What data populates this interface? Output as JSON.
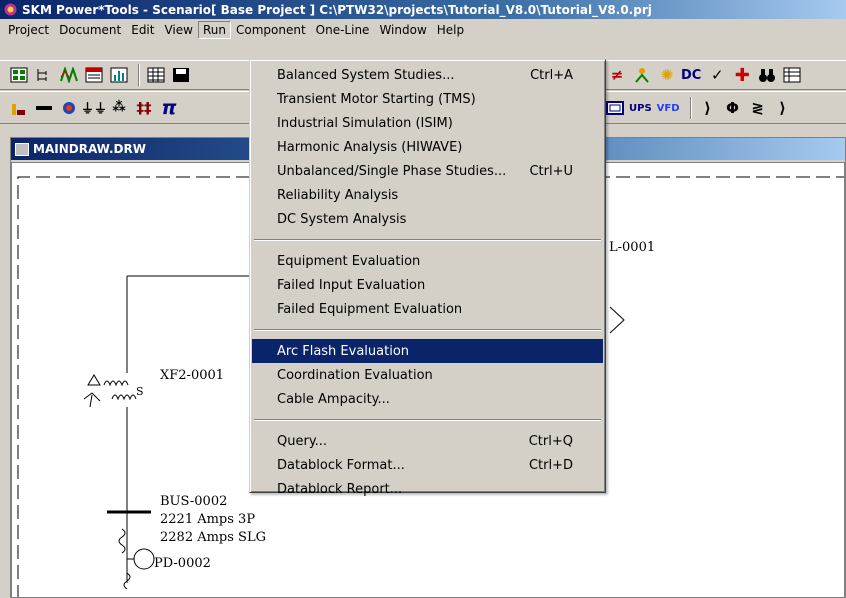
{
  "window": {
    "title": "SKM Power*Tools - Scenario[ Base Project ] C:\\PTW32\\projects\\Tutorial_V8.0\\Tutorial_V8.0.prj"
  },
  "menubar": {
    "items": [
      {
        "label": "Project"
      },
      {
        "label": "Document"
      },
      {
        "label": "Edit"
      },
      {
        "label": "View"
      },
      {
        "label": "Run"
      },
      {
        "label": "Component"
      },
      {
        "label": "One-Line"
      },
      {
        "label": "Window"
      },
      {
        "label": "Help"
      }
    ]
  },
  "toolbar2": {
    "ups_label": "UPS",
    "vfd_label": "VFD"
  },
  "toolbar_text": {
    "dc_label": "DC"
  },
  "document": {
    "title": "MAINDRAW.DRW"
  },
  "diagram": {
    "line_label": "L-0001",
    "transformer_label": "XF2-0001",
    "bus_label": "BUS-0002",
    "bus_amps_3p": "2221 Amps 3P",
    "bus_amps_slg": "2282 Amps SLG",
    "pd_label": "PD-0002",
    "transformer_s": "S"
  },
  "run_menu": {
    "group1": [
      {
        "label": "Balanced System Studies...",
        "shortcut": "Ctrl+A"
      },
      {
        "label": "Transient Motor Starting (TMS)",
        "shortcut": ""
      },
      {
        "label": "Industrial Simulation (ISIM)",
        "shortcut": ""
      },
      {
        "label": "Harmonic Analysis (HIWAVE)",
        "shortcut": ""
      },
      {
        "label": "Unbalanced/Single Phase Studies...",
        "shortcut": "Ctrl+U"
      },
      {
        "label": "Reliability Analysis",
        "shortcut": ""
      },
      {
        "label": "DC System Analysis",
        "shortcut": ""
      }
    ],
    "group2": [
      {
        "label": "Equipment Evaluation",
        "shortcut": ""
      },
      {
        "label": "Failed Input Evaluation",
        "shortcut": ""
      },
      {
        "label": "Failed Equipment Evaluation",
        "shortcut": ""
      }
    ],
    "group3": [
      {
        "label": "Arc Flash Evaluation",
        "shortcut": ""
      },
      {
        "label": "Coordination Evaluation",
        "shortcut": ""
      },
      {
        "label": "Cable Ampacity...",
        "shortcut": ""
      }
    ],
    "group4": [
      {
        "label": "Query...",
        "shortcut": "Ctrl+Q"
      },
      {
        "label": "Datablock Format...",
        "shortcut": "Ctrl+D"
      },
      {
        "label": "Datablock Report...",
        "shortcut": ""
      }
    ],
    "highlighted": "Arc Flash Evaluation"
  },
  "colors": {
    "title_start": "#0a246a",
    "highlight": "#0a246a",
    "face": "#d4d0c8"
  }
}
